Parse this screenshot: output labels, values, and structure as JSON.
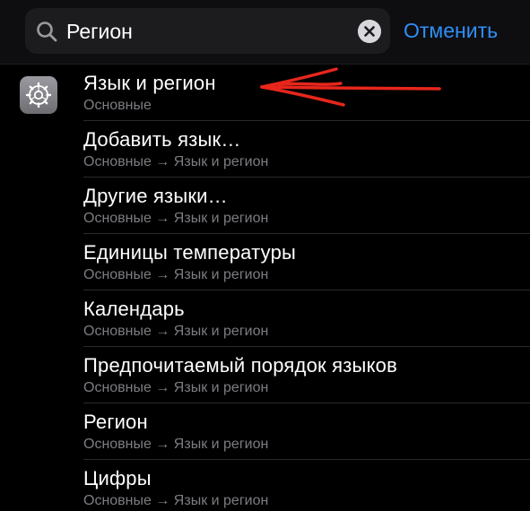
{
  "search": {
    "value": "Регион",
    "cancel_label": "Отменить"
  },
  "results": [
    {
      "title": "Язык и регион",
      "subtitle": "Основные"
    },
    {
      "title": "Добавить язык…",
      "subtitle": "Основные → Язык и регион"
    },
    {
      "title": "Другие языки…",
      "subtitle": "Основные → Язык и регион"
    },
    {
      "title": "Единицы температуры",
      "subtitle": "Основные → Язык и регион"
    },
    {
      "title": "Календарь",
      "subtitle": "Основные → Язык и регион"
    },
    {
      "title": "Предпочитаемый порядок языков",
      "subtitle": "Основные → Язык и регион"
    },
    {
      "title": "Регион",
      "subtitle": "Основные → Язык и регион"
    },
    {
      "title": "Цифры",
      "subtitle": "Основные → Язык и регион"
    }
  ],
  "icons": {
    "search": "search-icon",
    "clear": "clear-icon",
    "app": "settings-gear-icon"
  },
  "colors": {
    "accent": "#2f8ff8",
    "annotation": "#e8261c",
    "subtitle": "#7c7c82"
  }
}
